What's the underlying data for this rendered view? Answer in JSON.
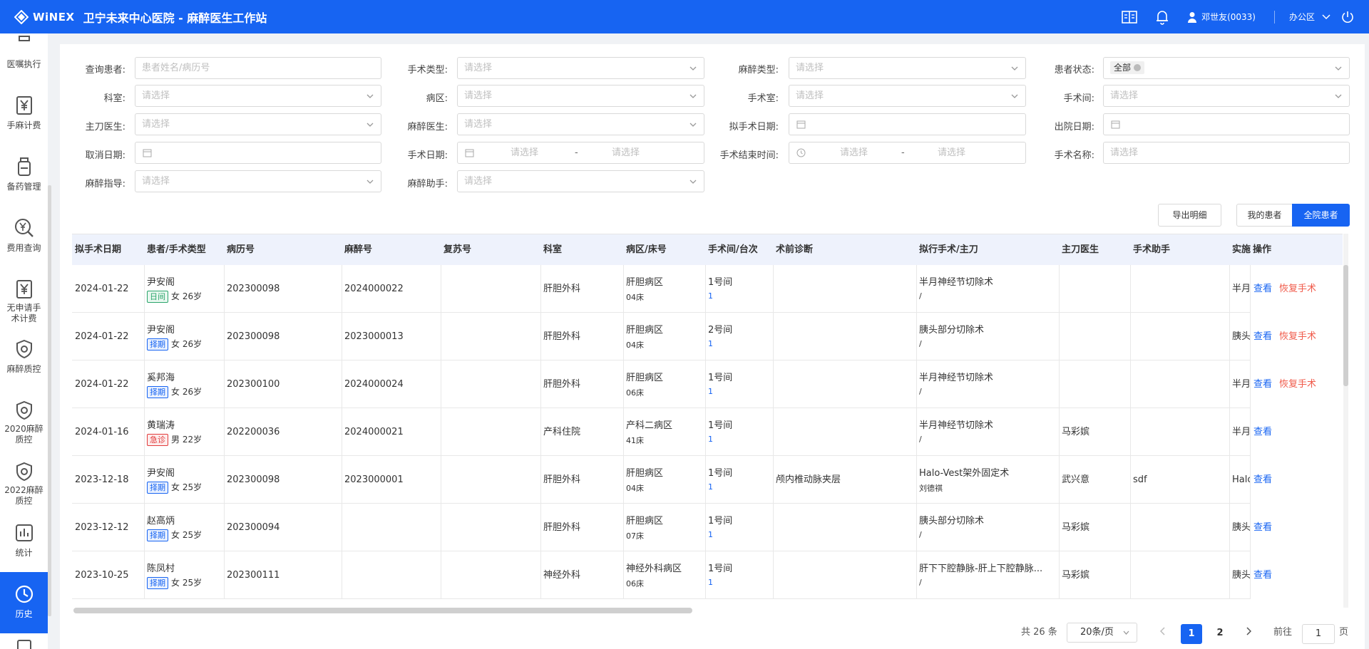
{
  "header": {
    "brand": "WiNEX",
    "title": "卫宁未来中心医院 - 麻醉医生工作站",
    "user": "邓世友(0033)",
    "office": "办公区"
  },
  "sidebar": {
    "items": [
      {
        "label": "医嘱执行",
        "icon": "clipboard-icon"
      },
      {
        "label": "手麻计费",
        "icon": "yen-doc-icon"
      },
      {
        "label": "备药管理",
        "icon": "medicine-bottle-icon"
      },
      {
        "label": "费用查询",
        "icon": "yen-search-icon"
      },
      {
        "label": "无申请手术计费",
        "icon": "yen-doc-icon"
      },
      {
        "label": "麻醉质控",
        "icon": "shield-icon"
      },
      {
        "label": "2020麻醉质控",
        "icon": "shield-icon"
      },
      {
        "label": "2022麻醉质控",
        "icon": "shield-icon"
      },
      {
        "label": "统计",
        "icon": "bar-chart-icon"
      },
      {
        "label": "历史",
        "icon": "clock-icon"
      }
    ]
  },
  "filters": {
    "query_patient": {
      "label": "查询患者:",
      "placeholder": "患者姓名/病历号"
    },
    "surgery_type": {
      "label": "手术类型:",
      "placeholder": "请选择"
    },
    "anesthesia_type": {
      "label": "麻醉类型:",
      "placeholder": "请选择"
    },
    "patient_status": {
      "label": "患者状态:",
      "value": "全部"
    },
    "department": {
      "label": "科室:",
      "placeholder": "请选择"
    },
    "ward": {
      "label": "病区:",
      "placeholder": "请选择"
    },
    "operating_room": {
      "label": "手术室:",
      "placeholder": "请选择"
    },
    "surgery_room": {
      "label": "手术间:",
      "placeholder": "请选择"
    },
    "chief_surgeon": {
      "label": "主刀医生:",
      "placeholder": "请选择"
    },
    "anesthesiologist": {
      "label": "麻醉医生:",
      "placeholder": "请选择"
    },
    "planned_date": {
      "label": "拟手术日期:"
    },
    "discharge_date": {
      "label": "出院日期:"
    },
    "cancel_date": {
      "label": "取消日期:"
    },
    "surgery_date": {
      "label": "手术日期:",
      "start": "请选择",
      "sep": "-",
      "end": "请选择"
    },
    "surgery_end_time": {
      "label": "手术结束时间:",
      "start": "请选择",
      "sep": "-",
      "end": "请选择"
    },
    "surgery_name": {
      "label": "手术名称:",
      "placeholder": "请选择"
    },
    "anesthesia_guide": {
      "label": "麻醉指导:",
      "placeholder": "请选择"
    },
    "anesthesia_assistant": {
      "label": "麻醉助手:",
      "placeholder": "请选择"
    }
  },
  "actions": {
    "export": "导出明细",
    "my_patients": "我的患者",
    "all_patients": "全院患者"
  },
  "table": {
    "columns": [
      "拟手术日期",
      "患者/手术类型",
      "病历号",
      "麻醉号",
      "复苏号",
      "科室",
      "病区/床号",
      "手术间/台次",
      "术前诊断",
      "拟行手术/主刀",
      "主刀医生",
      "手术助手",
      "实施",
      "操作"
    ],
    "rows": [
      {
        "date": "2024-01-22",
        "name": "尹安阁",
        "badge": "日间",
        "badge_kind": "day",
        "info": "女 26岁",
        "mrn": "202300098",
        "anes": "2024000022",
        "recov": "",
        "dept": "肝胆外科",
        "ward": "肝胆病区",
        "bed": "04床",
        "room": "1号间",
        "seq": "1",
        "diag": "",
        "op": "半月神经节切除术",
        "op2": "/",
        "surgeon": "",
        "assist": "",
        "impl": "半月",
        "view": "查看",
        "restore": "恢复手术"
      },
      {
        "date": "2024-01-22",
        "name": "尹安阁",
        "badge": "择期",
        "badge_kind": "sel",
        "info": "女 26岁",
        "mrn": "202300098",
        "anes": "2023000013",
        "recov": "",
        "dept": "肝胆外科",
        "ward": "肝胆病区",
        "bed": "04床",
        "room": "2号间",
        "seq": "1",
        "diag": "",
        "op": "胰头部分切除术",
        "op2": "/",
        "surgeon": "",
        "assist": "",
        "impl": "胰头",
        "view": "查看",
        "restore": "恢复手术"
      },
      {
        "date": "2024-01-22",
        "name": "奚邦海",
        "badge": "择期",
        "badge_kind": "sel",
        "info": "女 26岁",
        "mrn": "202300100",
        "anes": "2024000024",
        "recov": "",
        "dept": "肝胆外科",
        "ward": "肝胆病区",
        "bed": "06床",
        "room": "1号间",
        "seq": "1",
        "diag": "",
        "op": "半月神经节切除术",
        "op2": "/",
        "surgeon": "",
        "assist": "",
        "impl": "半月",
        "view": "查看",
        "restore": "恢复手术"
      },
      {
        "date": "2024-01-16",
        "name": "黄瑞涛",
        "badge": "急诊",
        "badge_kind": "emg",
        "info": "男 22岁",
        "mrn": "202200036",
        "anes": "2024000021",
        "recov": "",
        "dept": "产科住院",
        "ward": "产科二病区",
        "bed": "41床",
        "room": "1号间",
        "seq": "1",
        "diag": "",
        "op": "半月神经节切除术",
        "op2": "/",
        "surgeon": "马彩嫔",
        "assist": "",
        "impl": "半月",
        "view": "查看",
        "restore": ""
      },
      {
        "date": "2023-12-18",
        "name": "尹安阁",
        "badge": "择期",
        "badge_kind": "sel",
        "info": "女 25岁",
        "mrn": "202300098",
        "anes": "2023000001",
        "recov": "",
        "dept": "肝胆外科",
        "ward": "肝胆病区",
        "bed": "04床",
        "room": "1号间",
        "seq": "1",
        "diag": "颅内椎动脉夹层",
        "op": "Halo-Vest架外固定术",
        "op2": "刘德祺",
        "surgeon": "武兴意",
        "assist": "sdf",
        "impl": "Halo",
        "view": "查看",
        "restore": ""
      },
      {
        "date": "2023-12-12",
        "name": "赵高炳",
        "badge": "择期",
        "badge_kind": "sel",
        "info": "女 25岁",
        "mrn": "202300094",
        "anes": "",
        "recov": "",
        "dept": "肝胆外科",
        "ward": "肝胆病区",
        "bed": "07床",
        "room": "1号间",
        "seq": "1",
        "diag": "",
        "op": "胰头部分切除术",
        "op2": "/",
        "surgeon": "马彩嫔",
        "assist": "",
        "impl": "胰头",
        "view": "查看",
        "restore": ""
      },
      {
        "date": "2023-10-25",
        "name": "陈凤村",
        "badge": "择期",
        "badge_kind": "sel",
        "info": "女 25岁",
        "mrn": "202300111",
        "anes": "",
        "recov": "",
        "dept": "神经外科",
        "ward": "神经外科病区",
        "bed": "06床",
        "room": "1号间",
        "seq": "1",
        "diag": "",
        "op": "肝下下腔静脉-肝上下腔静脉...",
        "op2": "/",
        "surgeon": "马彩嫔",
        "assist": "",
        "impl": "胰头",
        "view": "查看",
        "restore": ""
      }
    ]
  },
  "pagination": {
    "total": "共 26 条",
    "page_size": "20条/页",
    "pages": [
      "1",
      "2"
    ],
    "current": "1",
    "goto_label": "前往",
    "goto_value": "1",
    "page_unit": "页"
  }
}
